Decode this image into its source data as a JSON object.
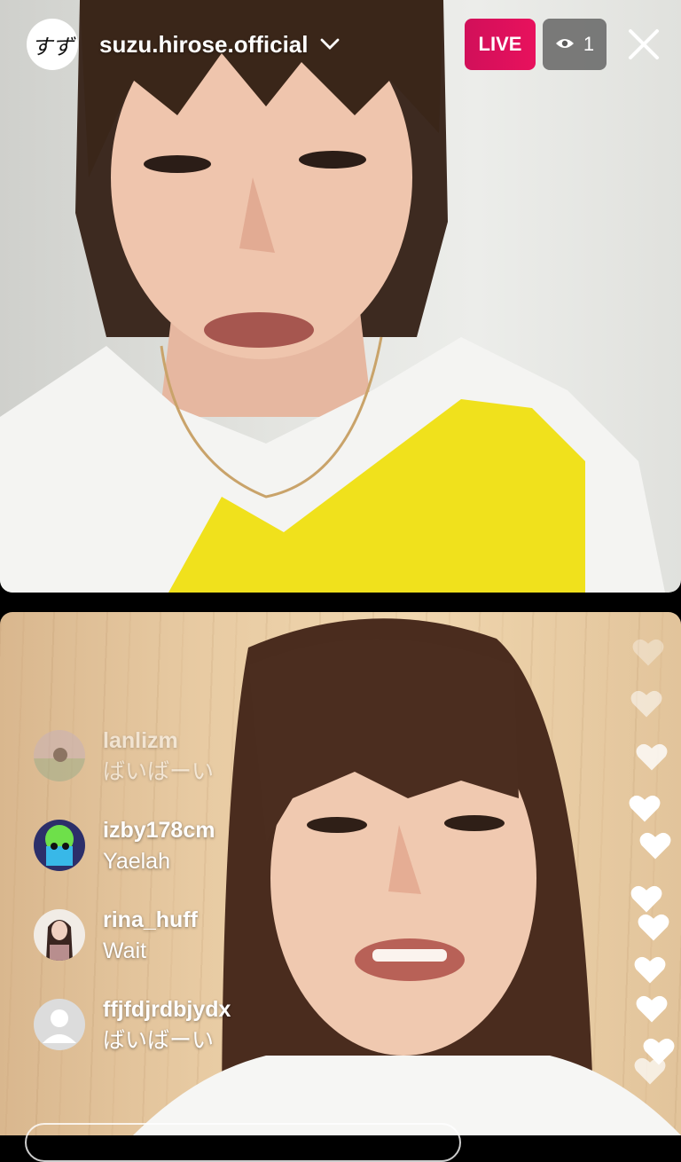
{
  "header": {
    "avatar_initials": "すず",
    "username": "suzu.hirose.official",
    "live_label": "LIVE",
    "viewer_count": "1"
  },
  "comments": [
    {
      "username": "lanlizm",
      "message": "ばいばーい"
    },
    {
      "username": "izby178cm",
      "message": "Yaelah"
    },
    {
      "username": "rina_huff",
      "message": "Wait"
    },
    {
      "username": "ffjfdjrdbjydx",
      "message": "ばいばーい"
    }
  ],
  "colors": {
    "live_badge": "#e0115e",
    "viewer_badge": "#5a5a5a",
    "text": "#ffffff"
  }
}
